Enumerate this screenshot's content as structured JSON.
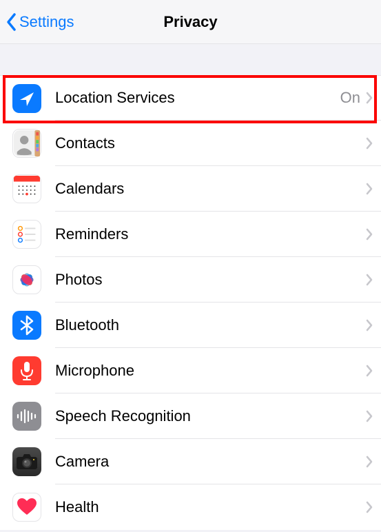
{
  "nav": {
    "back_label": "Settings",
    "title": "Privacy"
  },
  "rows": {
    "location": {
      "label": "Location Services",
      "value": "On"
    },
    "contacts": {
      "label": "Contacts"
    },
    "calendars": {
      "label": "Calendars"
    },
    "reminders": {
      "label": "Reminders"
    },
    "photos": {
      "label": "Photos"
    },
    "bluetooth": {
      "label": "Bluetooth"
    },
    "microphone": {
      "label": "Microphone"
    },
    "speech": {
      "label": "Speech Recognition"
    },
    "camera": {
      "label": "Camera"
    },
    "health": {
      "label": "Health"
    }
  }
}
